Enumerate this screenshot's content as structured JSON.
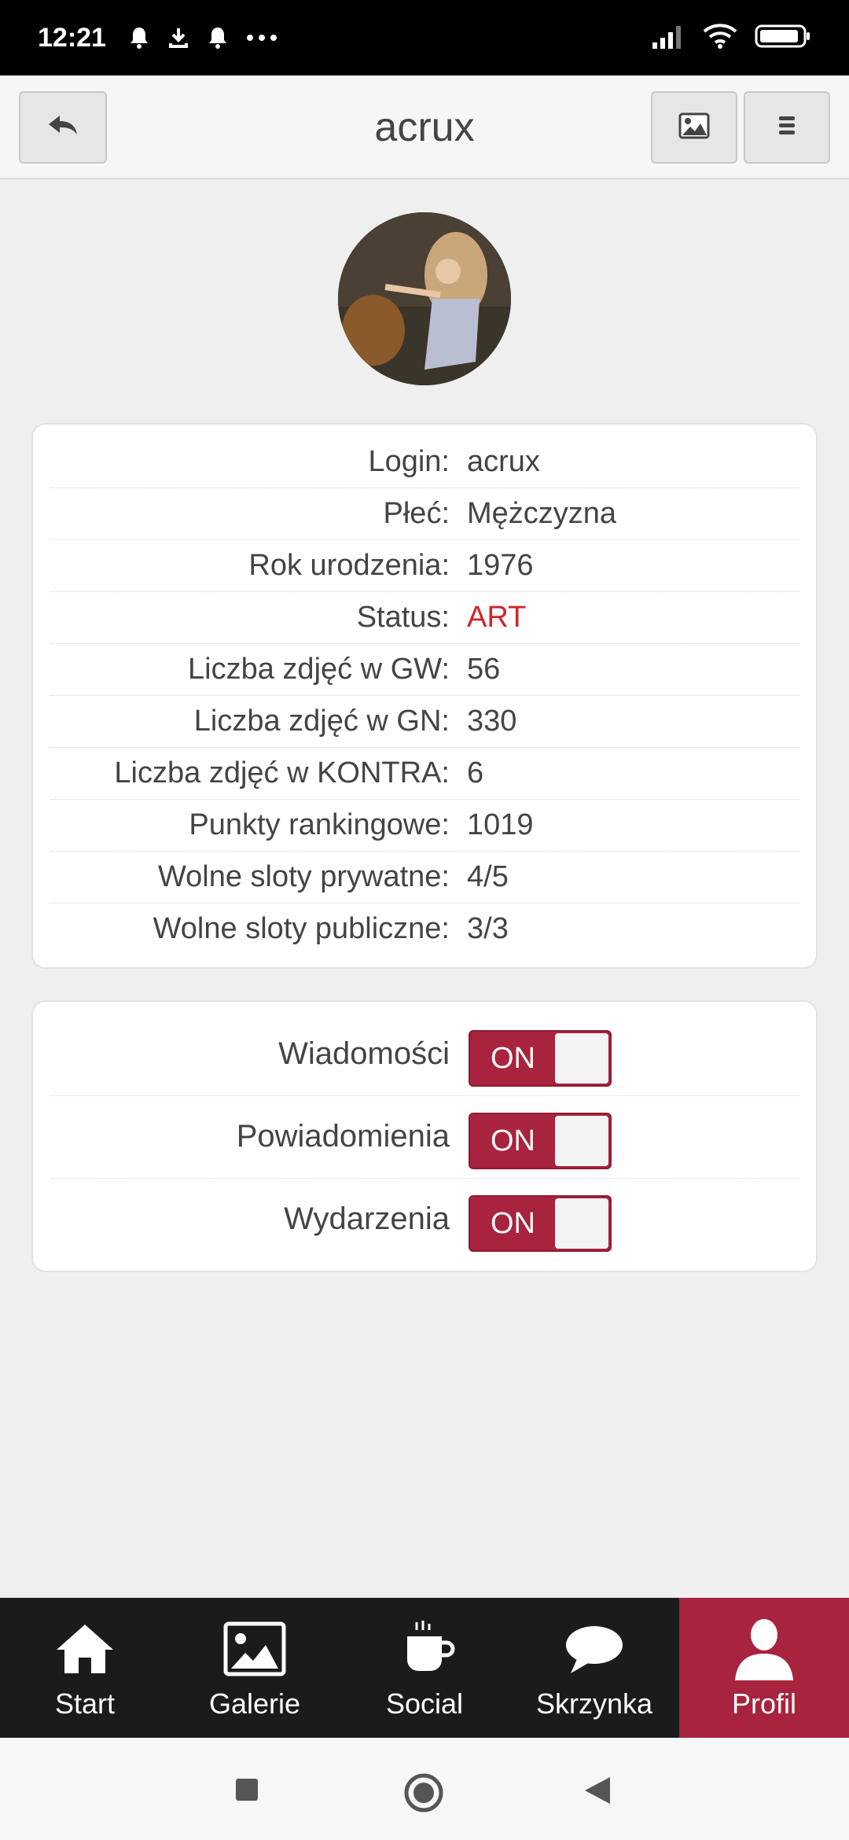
{
  "status_bar": {
    "time": "12:21"
  },
  "header": {
    "title": "acrux"
  },
  "profile_info": [
    {
      "label": "Login:",
      "value": "acrux"
    },
    {
      "label": "Płeć:",
      "value": "Mężczyzna"
    },
    {
      "label": "Rok urodzenia:",
      "value": "1976"
    },
    {
      "label": "Status:",
      "value": "ART"
    },
    {
      "label": "Liczba zdjęć w GW:",
      "value": "56"
    },
    {
      "label": "Liczba zdjęć w GN:",
      "value": "330"
    },
    {
      "label": "Liczba zdjęć w KONTRA:",
      "value": "6"
    },
    {
      "label": "Punkty rankingowe:",
      "value": "1019"
    },
    {
      "label": "Wolne sloty prywatne:",
      "value": "4/5"
    },
    {
      "label": "Wolne sloty publiczne:",
      "value": "3/3"
    }
  ],
  "settings": [
    {
      "label": "Wiadomości",
      "state": "ON"
    },
    {
      "label": "Powiadomienia",
      "state": "ON"
    },
    {
      "label": "Wydarzenia",
      "state": "ON"
    }
  ],
  "bottom_nav": [
    {
      "label": "Start",
      "icon": "home-icon"
    },
    {
      "label": "Galerie",
      "icon": "image-icon"
    },
    {
      "label": "Social",
      "icon": "coffee-icon"
    },
    {
      "label": "Skrzynka",
      "icon": "chat-icon"
    },
    {
      "label": "Profil",
      "icon": "user-icon",
      "active": true
    }
  ],
  "colors": {
    "accent": "#a8233d",
    "status_red": "#d0242b"
  }
}
